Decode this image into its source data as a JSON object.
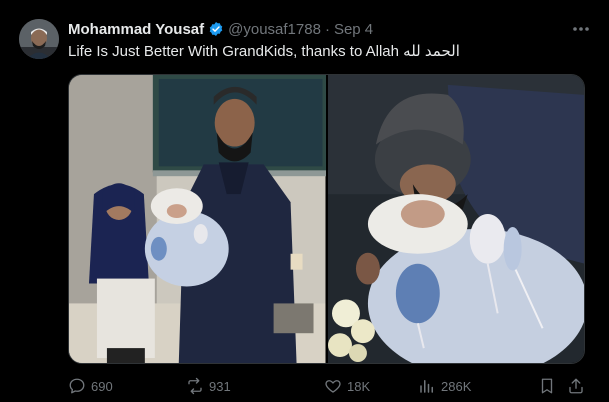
{
  "tweet": {
    "author_name": "Mohammad Yousaf",
    "handle": "@yousaf1788",
    "separator": "·",
    "date": "Sep 4",
    "text": "Life Is Just Better With GrandKids, thanks to Allah الحمد لله"
  },
  "media": {
    "images": [
      "left-photo",
      "right-photo"
    ]
  },
  "actions": {
    "replies": "690",
    "reposts": "931",
    "likes": "18K",
    "views": "286K"
  },
  "icons": {
    "verified": "verified-badge-icon",
    "more": "more-dots-icon",
    "reply": "reply-icon",
    "repost": "repost-icon",
    "like": "heart-icon",
    "views": "views-chart-icon",
    "bookmark": "bookmark-icon",
    "share": "share-icon"
  },
  "colors": {
    "background": "#000000",
    "text": "#e7e9ea",
    "muted": "#71767b",
    "verified": "#1d9bf0",
    "border": "#2f3336"
  }
}
